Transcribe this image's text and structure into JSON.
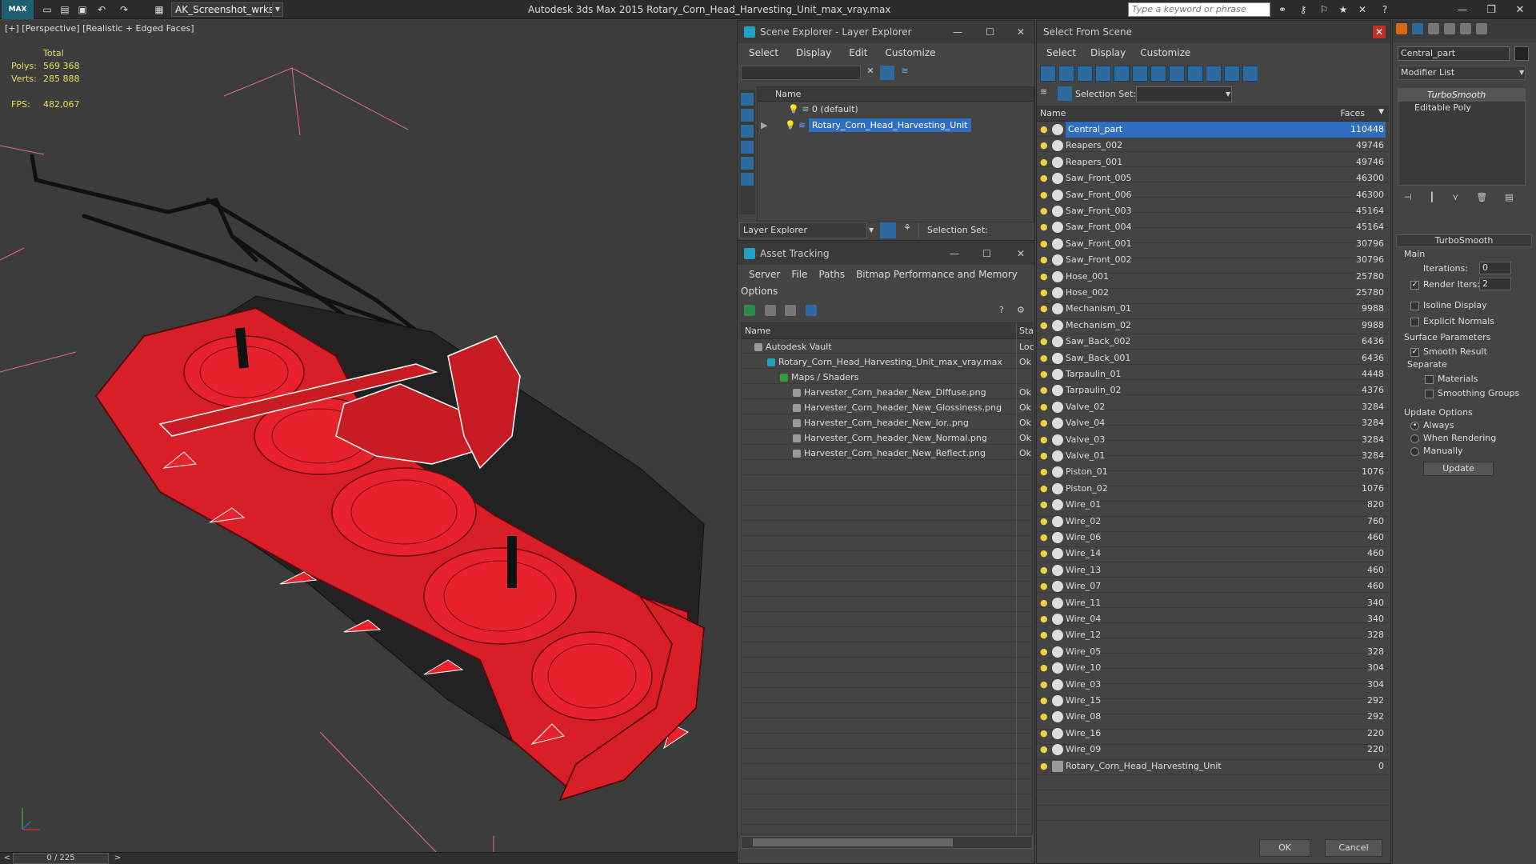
{
  "app": {
    "title": "Autodesk 3ds Max  2015    Rotary_Corn_Head_Harvesting_Unit_max_vray.max",
    "logo": "MAX",
    "workspace": "AK_Screenshot_wrksp",
    "search_placeholder": "Type a keyword or phrase"
  },
  "viewport": {
    "label": "[+] [Perspective] [Realistic + Edged Faces]",
    "stats": {
      "total_label": "Total",
      "polys_label": "Polys:",
      "polys": "569 368",
      "verts_label": "Verts:",
      "verts": "285 888",
      "fps_label": "FPS:",
      "fps": "482,067"
    },
    "timeline": "0 / 225"
  },
  "scene_explorer": {
    "title": "Scene Explorer - Layer Explorer",
    "menu": [
      "Select",
      "Display",
      "Edit",
      "Customize"
    ],
    "col_name": "Name",
    "layers": [
      {
        "label": "0 (default)",
        "selected": false
      },
      {
        "label": "Rotary_Corn_Head_Harvesting_Unit",
        "selected": true
      }
    ],
    "footer_dropdown": "Layer Explorer",
    "selection_set_label": "Selection Set:"
  },
  "asset_tracking": {
    "title": "Asset Tracking",
    "menu": [
      "Server",
      "File",
      "Paths",
      "Bitmap Performance and Memory"
    ],
    "menu2": "Options",
    "col_name": "Name",
    "col_status": "Sta",
    "rows": [
      {
        "name": "Autodesk Vault",
        "status": "Loc",
        "indent": 1
      },
      {
        "name": "Rotary_Corn_Head_Harvesting_Unit_max_vray.max",
        "status": "Ok",
        "indent": 2
      },
      {
        "name": "Maps / Shaders",
        "status": "",
        "indent": 3
      },
      {
        "name": "Harvester_Corn_header_New_Diffuse.png",
        "status": "Ok",
        "indent": 4
      },
      {
        "name": "Harvester_Corn_header_New_Glossiness.png",
        "status": "Ok",
        "indent": 4
      },
      {
        "name": "Harvester_Corn_header_New_lor..png",
        "status": "Ok",
        "indent": 4
      },
      {
        "name": "Harvester_Corn_header_New_Normal.png",
        "status": "Ok",
        "indent": 4
      },
      {
        "name": "Harvester_Corn_header_New_Reflect.png",
        "status": "Ok",
        "indent": 4
      }
    ]
  },
  "select_from_scene": {
    "title": "Select From Scene",
    "menu": [
      "Select",
      "Display",
      "Customize"
    ],
    "selection_set_label": "Selection Set:",
    "col_name": "Name",
    "col_faces": "Faces",
    "ok": "OK",
    "cancel": "Cancel",
    "rows": [
      {
        "name": "Central_part",
        "faces": "110448",
        "selected": true
      },
      {
        "name": "Reapers_002",
        "faces": "49746"
      },
      {
        "name": "Reapers_001",
        "faces": "49746"
      },
      {
        "name": "Saw_Front_005",
        "faces": "46300"
      },
      {
        "name": "Saw_Front_006",
        "faces": "46300"
      },
      {
        "name": "Saw_Front_003",
        "faces": "45164"
      },
      {
        "name": "Saw_Front_004",
        "faces": "45164"
      },
      {
        "name": "Saw_Front_001",
        "faces": "30796"
      },
      {
        "name": "Saw_Front_002",
        "faces": "30796"
      },
      {
        "name": "Hose_001",
        "faces": "25780"
      },
      {
        "name": "Hose_002",
        "faces": "25780"
      },
      {
        "name": "Mechanism_01",
        "faces": "9988"
      },
      {
        "name": "Mechanism_02",
        "faces": "9988"
      },
      {
        "name": "Saw_Back_002",
        "faces": "6436"
      },
      {
        "name": "Saw_Back_001",
        "faces": "6436"
      },
      {
        "name": "Tarpaulin_01",
        "faces": "4448"
      },
      {
        "name": "Tarpaulin_02",
        "faces": "4376"
      },
      {
        "name": "Valve_02",
        "faces": "3284"
      },
      {
        "name": "Valve_04",
        "faces": "3284"
      },
      {
        "name": "Valve_03",
        "faces": "3284"
      },
      {
        "name": "Valve_01",
        "faces": "3284"
      },
      {
        "name": "Piston_01",
        "faces": "1076"
      },
      {
        "name": "Piston_02",
        "faces": "1076"
      },
      {
        "name": "Wire_01",
        "faces": "820"
      },
      {
        "name": "Wire_02",
        "faces": "760"
      },
      {
        "name": "Wire_06",
        "faces": "460"
      },
      {
        "name": "Wire_14",
        "faces": "460"
      },
      {
        "name": "Wire_13",
        "faces": "460"
      },
      {
        "name": "Wire_07",
        "faces": "460"
      },
      {
        "name": "Wire_11",
        "faces": "340"
      },
      {
        "name": "Wire_04",
        "faces": "340"
      },
      {
        "name": "Wire_12",
        "faces": "328"
      },
      {
        "name": "Wire_05",
        "faces": "328"
      },
      {
        "name": "Wire_10",
        "faces": "304"
      },
      {
        "name": "Wire_03",
        "faces": "304"
      },
      {
        "name": "Wire_15",
        "faces": "292"
      },
      {
        "name": "Wire_08",
        "faces": "292"
      },
      {
        "name": "Wire_16",
        "faces": "220"
      },
      {
        "name": "Wire_09",
        "faces": "220"
      },
      {
        "name": "Rotary_Corn_Head_Harvesting_Unit",
        "faces": "0",
        "group": true
      }
    ]
  },
  "command_panel": {
    "object_name": "Central_part",
    "modifier_list": "Modifier List",
    "stack": [
      "TurboSmooth",
      "Editable Poly"
    ],
    "rollout_title": "TurboSmooth",
    "main_label": "Main",
    "iterations_label": "Iterations:",
    "iterations": "0",
    "render_iters_label": "Render Iters:",
    "render_iters": "2",
    "isoline_label": "Isoline Display",
    "explicit_normals_label": "Explicit Normals",
    "surface_params_label": "Surface Parameters",
    "smooth_result_label": "Smooth Result",
    "separate_label": "Separate",
    "materials_label": "Materials",
    "smoothing_groups_label": "Smoothing Groups",
    "update_options_label": "Update Options",
    "always_label": "Always",
    "when_rendering_label": "When Rendering",
    "manually_label": "Manually",
    "update_button": "Update"
  },
  "colors": {
    "selection": "#2f6ec0",
    "model_red": "#e8202a",
    "stats_yellow": "#e8e060"
  }
}
